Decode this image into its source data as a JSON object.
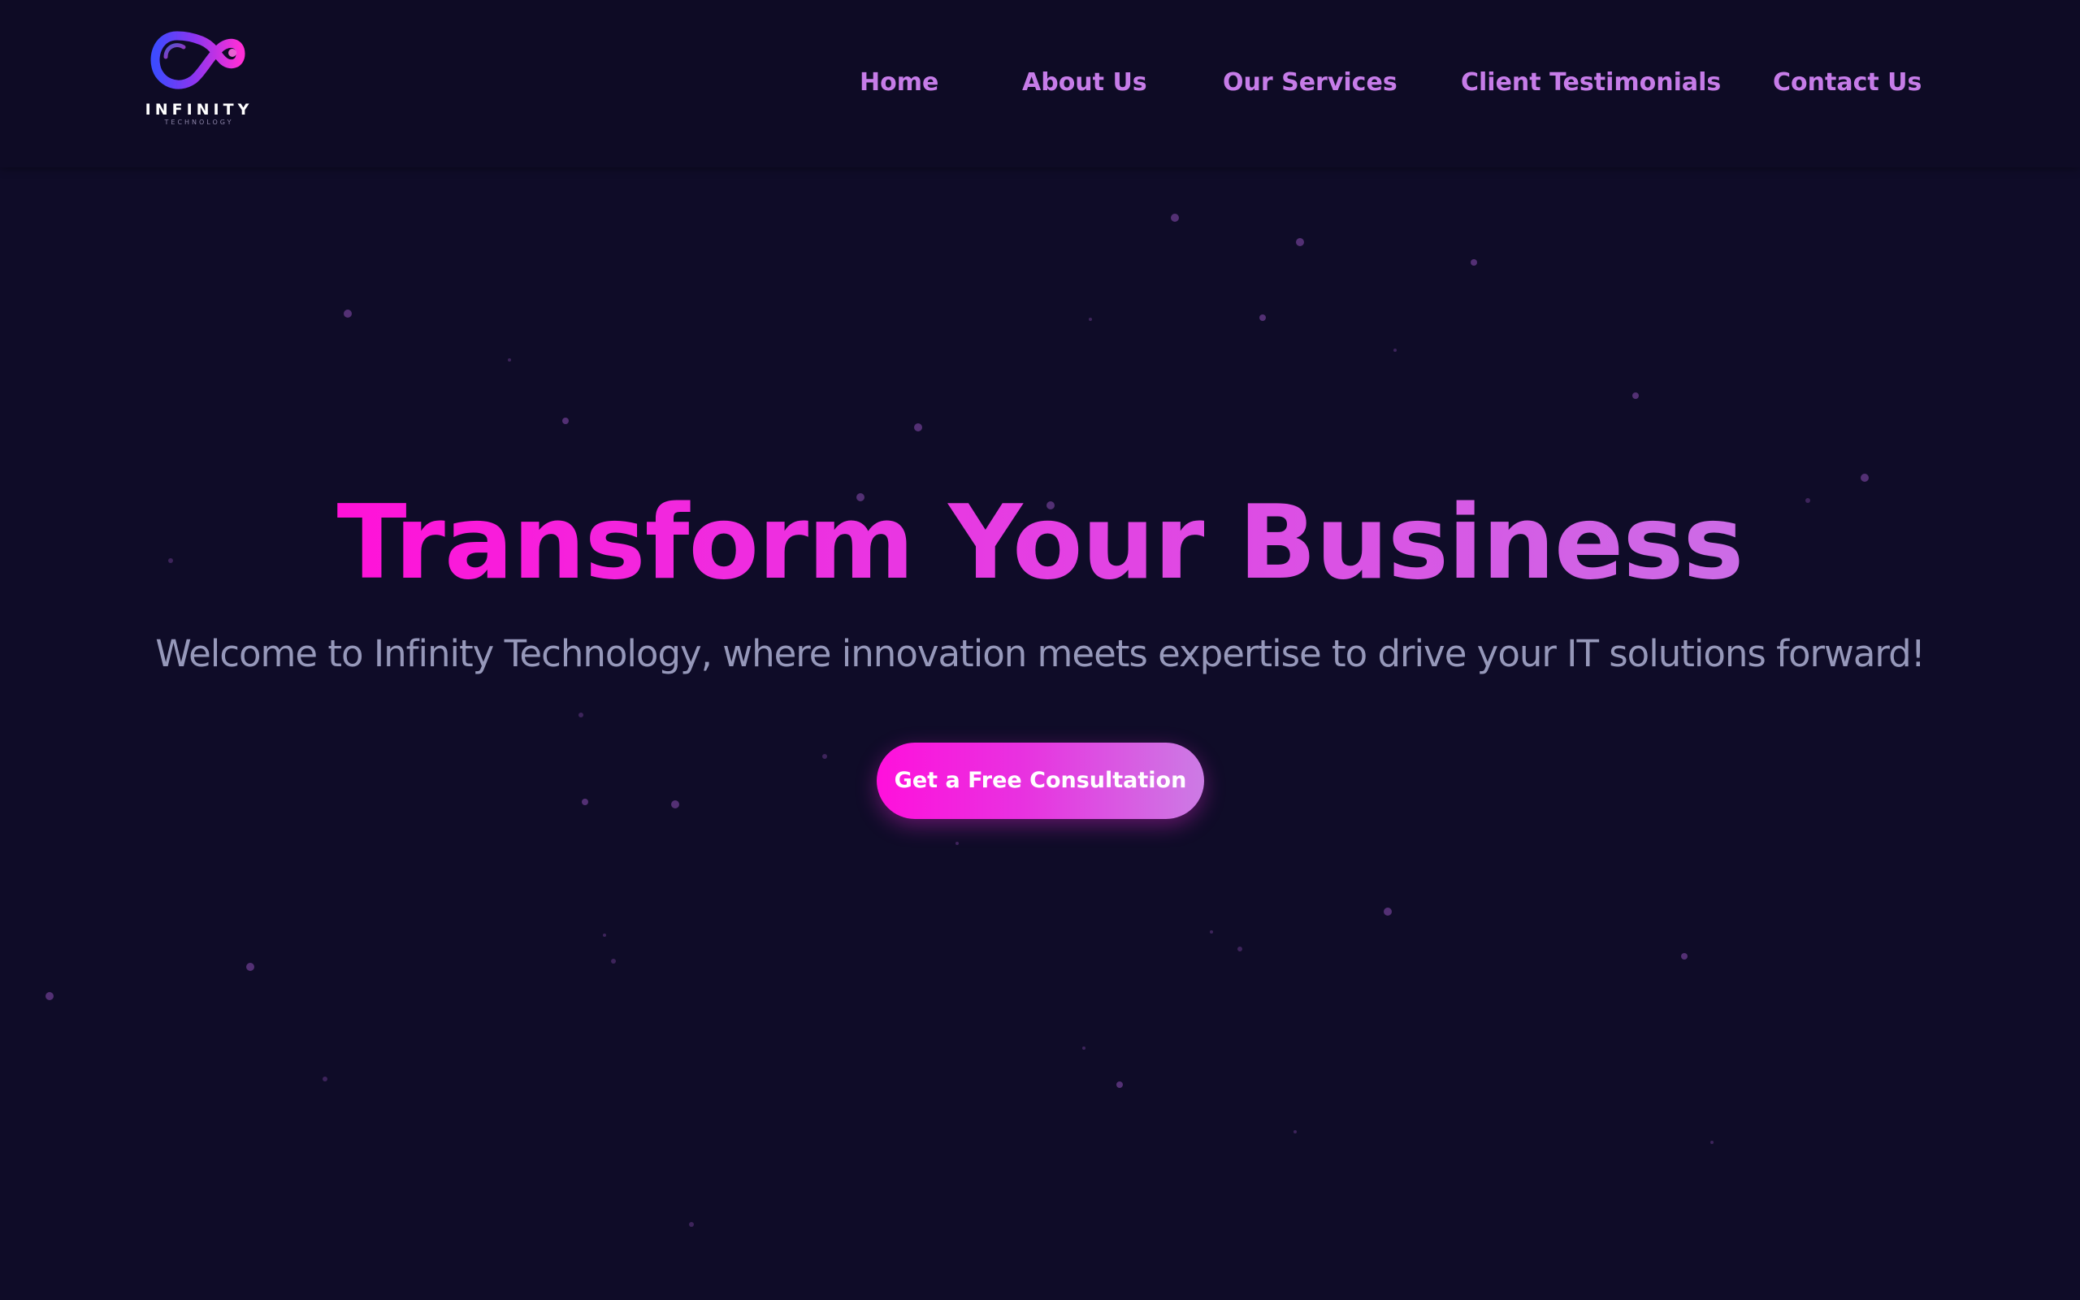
{
  "brand": {
    "name": "INFINITY",
    "tagline": "TECHNOLOGY",
    "logo_icon": "infinity-icon",
    "colors": {
      "background": "#0f0c28",
      "accent_pink": "#ff12d8",
      "accent_violet": "#cc6ce6",
      "nav_text": "#c67ce8",
      "subtitle_text": "#9698ba"
    }
  },
  "nav": {
    "items": [
      {
        "label": "Home"
      },
      {
        "label": "About Us"
      },
      {
        "label": "Our Services"
      },
      {
        "label": "Client Testimonials"
      },
      {
        "label": "Contact Us"
      }
    ]
  },
  "hero": {
    "title": "Transform Your Business",
    "subtitle": "Welcome to Infinity Technology, where innovation meets expertise to drive your IT solutions forward!",
    "cta_label": "Get a Free Consultation"
  }
}
